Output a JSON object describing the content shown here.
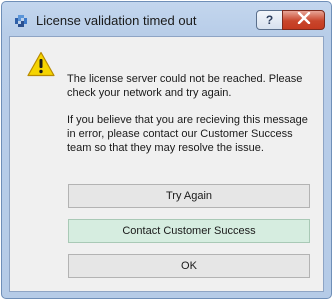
{
  "window": {
    "title": "License validation timed out",
    "help_label": "?"
  },
  "message": {
    "line1": "The license server could not be reached. Please check your network and try again.",
    "line2": "If you believe that you are recieving this message in error, please contact our Customer Success team so that they may resolve the issue."
  },
  "buttons": {
    "try_again": "Try Again",
    "contact": "Contact Customer Success",
    "ok": "OK"
  },
  "icons": {
    "app": "app-icon",
    "warning": "warning-icon",
    "help": "help-icon",
    "close": "close-icon"
  },
  "colors": {
    "contact_button_bg": "#d6ede0",
    "warning_yellow": "#f5d400",
    "close_red": "#c9462c"
  }
}
